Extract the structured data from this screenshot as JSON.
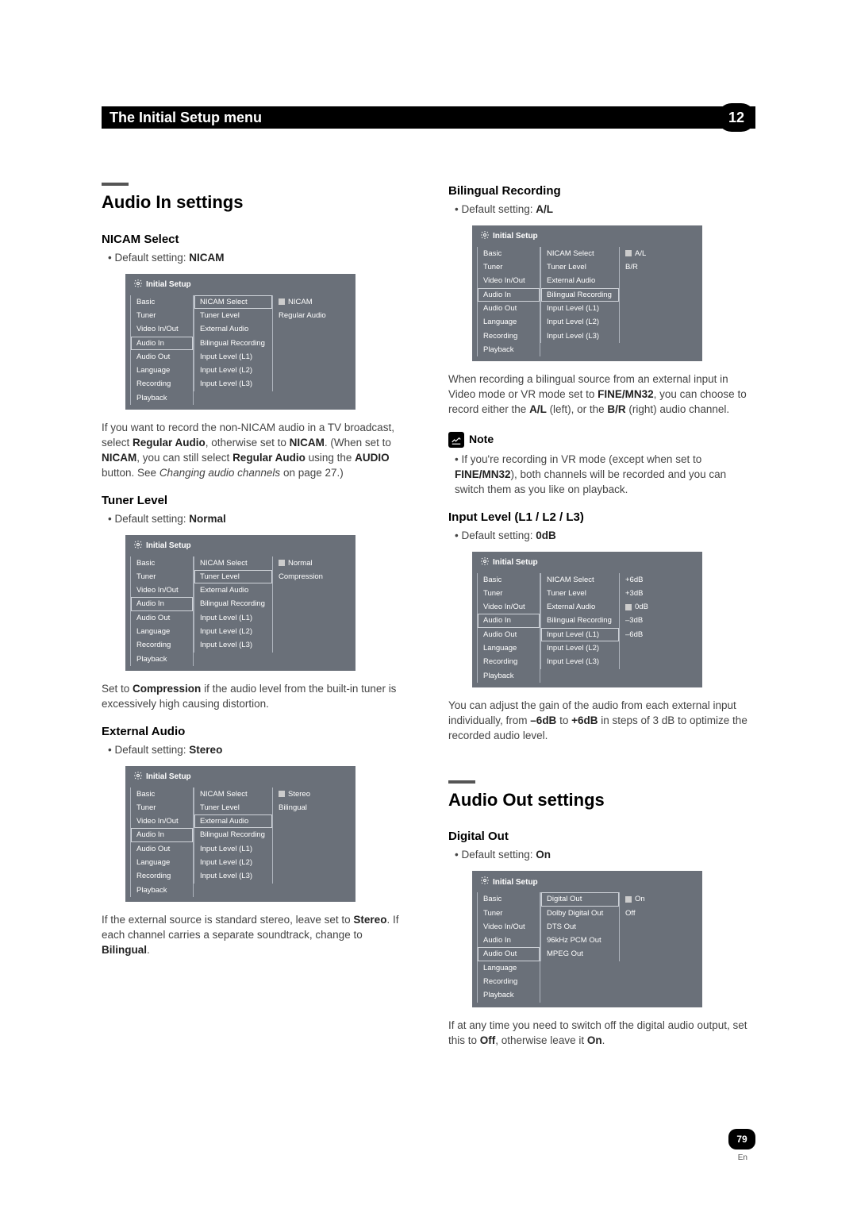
{
  "header": {
    "title": "The Initial Setup menu",
    "chapter": "12"
  },
  "footer": {
    "page": "79",
    "lang": "En"
  },
  "left": {
    "h1": "Audio In settings",
    "nicam": {
      "heading": "NICAM Select",
      "default_label": "Default setting: ",
      "default_value": "NICAM",
      "menu": {
        "title": "Initial Setup",
        "c1": [
          "Basic",
          "Tuner",
          "Video In/Out",
          "Audio In",
          "Audio Out",
          "Language",
          "Recording",
          "Playback"
        ],
        "c1_active": 3,
        "c2": [
          "NICAM Select",
          "Tuner Level",
          "External Audio",
          "Bilingual Recording",
          "Input Level (L1)",
          "Input Level (L2)",
          "Input Level (L3)"
        ],
        "c2_active": 0,
        "c3": [
          "NICAM",
          "Regular Audio"
        ],
        "c3_sel": 0
      },
      "para_parts": [
        "If you want to record the non-NICAM audio in a TV broadcast, select ",
        "Regular Audio",
        ", otherwise set to ",
        "NICAM",
        ". (When set to ",
        "NICAM",
        ", you can still select ",
        "Regular Audio",
        " using the ",
        "AUDIO",
        " button. See ",
        "Changing audio channels",
        " on page 27.)"
      ]
    },
    "tuner": {
      "heading": "Tuner Level",
      "default_label": "Default setting: ",
      "default_value": "Normal",
      "menu": {
        "title": "Initial Setup",
        "c1": [
          "Basic",
          "Tuner",
          "Video In/Out",
          "Audio In",
          "Audio Out",
          "Language",
          "Recording",
          "Playback"
        ],
        "c1_active": 3,
        "c2": [
          "NICAM Select",
          "Tuner Level",
          "External Audio",
          "Bilingual Recording",
          "Input Level (L1)",
          "Input Level (L2)",
          "Input Level (L3)"
        ],
        "c2_active": 1,
        "c3": [
          "Normal",
          "Compression"
        ],
        "c3_sel": 0
      },
      "para_parts": [
        "Set to ",
        "Compression",
        " if the audio level from the built-in tuner is excessively high causing distortion."
      ]
    },
    "external": {
      "heading": "External Audio",
      "default_label": "Default setting: ",
      "default_value": "Stereo",
      "menu": {
        "title": "Initial Setup",
        "c1": [
          "Basic",
          "Tuner",
          "Video In/Out",
          "Audio In",
          "Audio Out",
          "Language",
          "Recording",
          "Playback"
        ],
        "c1_active": 3,
        "c2": [
          "NICAM Select",
          "Tuner Level",
          "External Audio",
          "Bilingual Recording",
          "Input Level (L1)",
          "Input Level (L2)",
          "Input Level (L3)"
        ],
        "c2_active": 2,
        "c3": [
          "Stereo",
          "Bilingual"
        ],
        "c3_sel": 0
      },
      "para_parts": [
        "If the external source is standard stereo, leave set to ",
        "Stereo",
        ". If each channel carries a separate soundtrack, change to ",
        "Bilingual",
        "."
      ]
    }
  },
  "right": {
    "bilingual": {
      "heading": "Bilingual Recording",
      "default_label": "Default setting: ",
      "default_value": "A/L",
      "menu": {
        "title": "Initial Setup",
        "c1": [
          "Basic",
          "Tuner",
          "Video In/Out",
          "Audio In",
          "Audio Out",
          "Language",
          "Recording",
          "Playback"
        ],
        "c1_active": 3,
        "c2": [
          "NICAM Select",
          "Tuner Level",
          "External Audio",
          "Bilingual Recording",
          "Input Level (L1)",
          "Input Level (L2)",
          "Input Level (L3)"
        ],
        "c2_active": 3,
        "c3": [
          "A/L",
          "B/R"
        ],
        "c3_sel": 0
      },
      "para_parts": [
        "When recording a bilingual source from an external input in Video mode or VR mode set to ",
        "FINE/MN32",
        ", you can choose to record either the ",
        "A/L",
        " (left), or the ",
        "B/R",
        " (right) audio channel."
      ]
    },
    "note": {
      "label": "Note",
      "para_parts": [
        "If you're recording in VR mode (except when set to ",
        "FINE/MN32",
        "), both channels will be recorded and you can switch them as you like on playback."
      ]
    },
    "input": {
      "heading": "Input Level (L1 / L2 / L3)",
      "default_label": "Default setting: ",
      "default_value": "0dB",
      "menu": {
        "title": "Initial Setup",
        "c1": [
          "Basic",
          "Tuner",
          "Video In/Out",
          "Audio In",
          "Audio Out",
          "Language",
          "Recording",
          "Playback"
        ],
        "c1_active": 3,
        "c2": [
          "NICAM Select",
          "Tuner Level",
          "External Audio",
          "Bilingual Recording",
          "Input Level (L1)",
          "Input Level (L2)",
          "Input Level (L3)"
        ],
        "c2_active": 4,
        "c3": [
          "+6dB",
          "+3dB",
          "0dB",
          "–3dB",
          "–6dB"
        ],
        "c3_sel": 2
      },
      "para_parts": [
        "You can adjust the gain of the audio from each external input individually, from ",
        "–6dB",
        " to ",
        "+6dB",
        " in steps of 3 dB to optimize the recorded audio level."
      ]
    },
    "h1b": "Audio Out settings",
    "digital": {
      "heading": "Digital Out",
      "default_label": "Default setting: ",
      "default_value": "On",
      "menu": {
        "title": "Initial Setup",
        "c1": [
          "Basic",
          "Tuner",
          "Video In/Out",
          "Audio In",
          "Audio Out",
          "Language",
          "Recording",
          "Playback"
        ],
        "c1_active": 4,
        "c2": [
          "Digital Out",
          "Dolby Digital Out",
          "DTS Out",
          "96kHz PCM Out",
          "MPEG Out"
        ],
        "c2_active": 0,
        "c3": [
          "On",
          "Off"
        ],
        "c3_sel": 0
      },
      "para_parts": [
        "If at any time you need to switch off the digital audio output, set this to ",
        "Off",
        ", otherwise leave it ",
        "On",
        "."
      ]
    }
  }
}
